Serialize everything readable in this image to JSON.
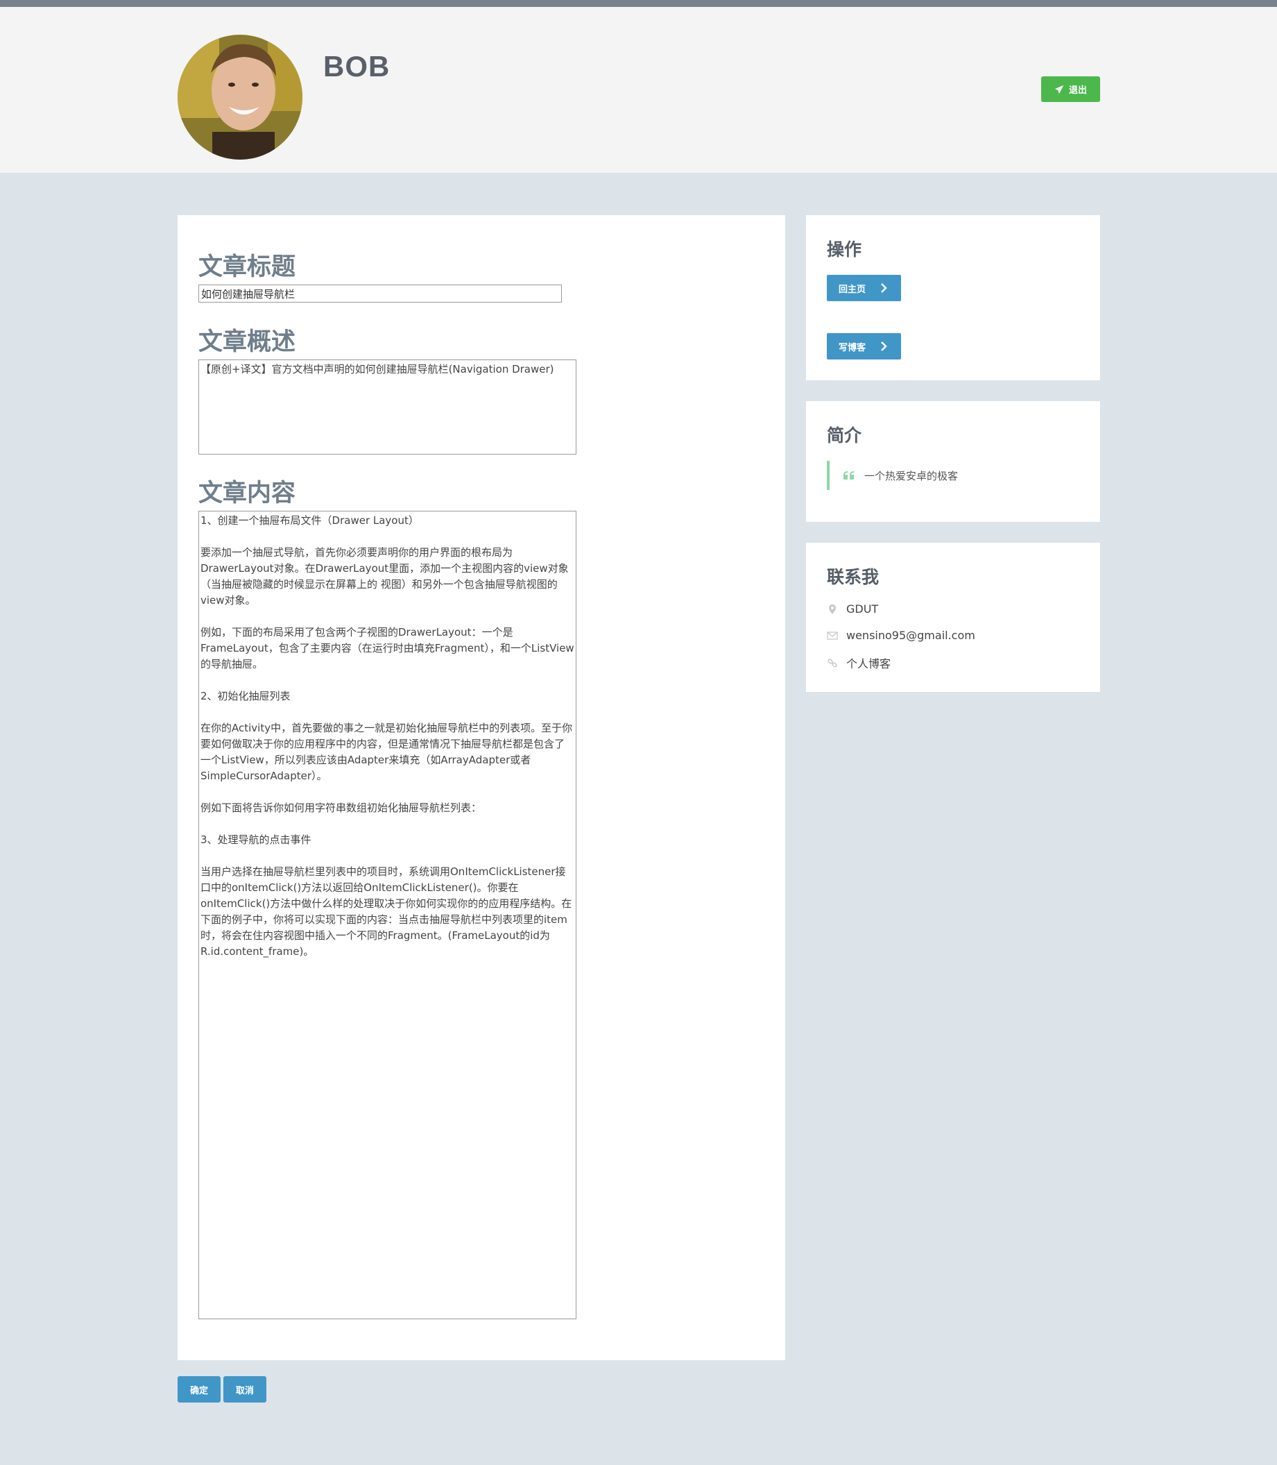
{
  "header": {
    "username": "BOB",
    "logout_label": "退出",
    "avatar_alt": "avatar"
  },
  "form": {
    "title_label": "文章标题",
    "title_value": "如何创建抽屉导航栏",
    "summary_label": "文章概述",
    "summary_value": "【原创+译文】官方文档中声明的如何创建抽屉导航栏(Navigation Drawer)",
    "content_label": "文章内容",
    "content_value": "1、创建一个抽屉布局文件（Drawer Layout）\n\n要添加一个抽屉式导航，首先你必须要声明你的用户界面的根布局为DrawerLayout对象。在DrawerLayout里面，添加一个主视图内容的view对象（当抽屉被隐藏的时候显示在屏幕上的 视图）和另外一个包含抽屉导航视图的view对象。\n\n例如，下面的布局采用了包含两个子视图的DrawerLayout：一个是FrameLayout，包含了主要内容（在运行时由填充Fragment），和一个ListView的导航抽屉。\n\n2、初始化抽屉列表\n\n在你的Activity中，首先要做的事之一就是初始化抽屉导航栏中的列表项。至于你要如何做取决于你的应用程序中的内容，但是通常情况下抽屉导航栏都是包含了一个ListView，所以列表应该由Adapter来填充（如ArrayAdapter或者SimpleCursorAdapter）。\n\n例如下面将告诉你如何用字符串数组初始化抽屉导航栏列表：\n\n3、处理导航的点击事件\n\n当用户选择在抽屉导航栏里列表中的项目时，系统调用OnItemClickListener接口中的onItemClick()方法以返回给OnItemClickListener()。你要在onItemClick()方法中做什么样的处理取决于你如何实现你的的应用程序结构。在下面的例子中，你将可以实现下面的内容：当点击抽屉导航栏中列表项里的item时，将会在住内容视图中插入一个不同的Fragment。(FrameLayout的id为 R.id.content_frame)。",
    "ok_label": "确定",
    "cancel_label": "取消"
  },
  "sidebar": {
    "operations": {
      "title": "操作",
      "home_label": "回主页",
      "write_label": "写博客"
    },
    "intro": {
      "title": "简介",
      "quote": "一个热爱安卓的极客"
    },
    "contact": {
      "title": "联系我",
      "location": "GDUT",
      "email": "wensino95@gmail.com",
      "blog": "个人博客"
    }
  },
  "colors": {
    "accent_blue": "#4196c8",
    "logout_green": "#4cb84c",
    "quote_border": "#8fd6a8",
    "page_bg": "#dce3e9"
  }
}
